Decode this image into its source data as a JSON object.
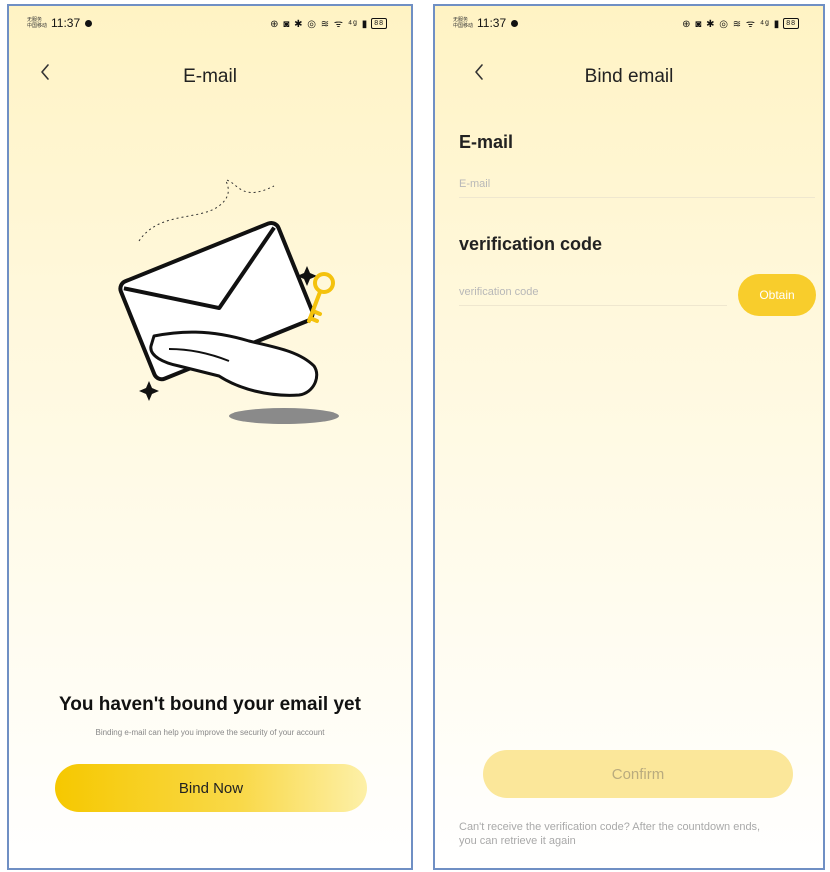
{
  "status_bar": {
    "carrier_line1": "无服务",
    "carrier_line2": "中国移动",
    "time": "11:37",
    "icons": "⊕ ◙ ✱ ◎ ≋ ᯤ ⁴ᵍ ▮",
    "battery": "88"
  },
  "left_screen": {
    "title": "E-mail",
    "headline": "You haven't bound your email yet",
    "subline": "Binding e-mail can help you improve the security of your account",
    "bind_button": "Bind Now"
  },
  "right_screen": {
    "title": "Bind email",
    "email_label": "E-mail",
    "email_placeholder": "E-mail",
    "email_value": "",
    "code_label": "verification code",
    "code_placeholder": "verification code",
    "code_value": "",
    "obtain_button": "Obtain",
    "confirm_button": "Confirm",
    "hint": "Can't receive the verification code? After the countdown ends, you can retrieve it again"
  },
  "colors": {
    "accent": "#f8cd2c",
    "confirm_disabled": "#fbe79a",
    "background_top": "#fff3c4",
    "border": "#6f8fc4"
  }
}
